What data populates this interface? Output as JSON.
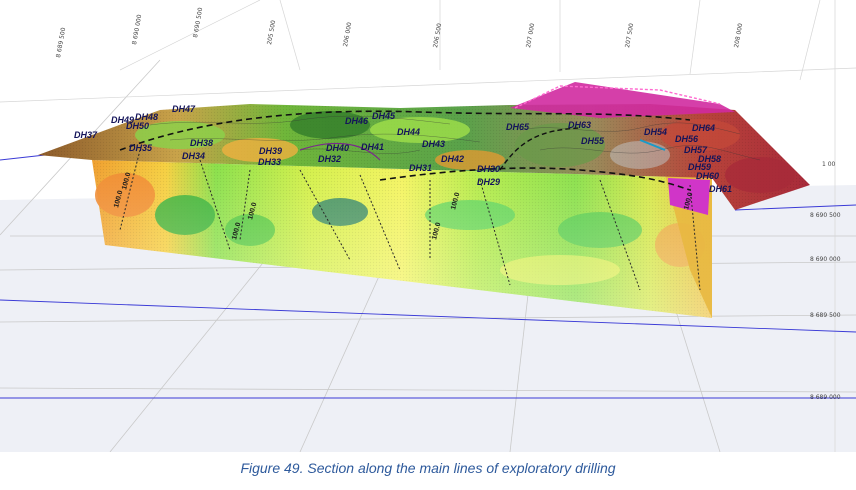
{
  "caption": "Figure 49. Section along the main lines of exploratory drilling",
  "colors": {
    "caption": "#2e5a9c",
    "label": "#14145a",
    "grid": "#c9c9c9",
    "boundary": "#2a2ad0"
  },
  "coords_top": [
    "8 689 500",
    "8 690 000",
    "8 690 500",
    "205 500",
    "206 000",
    "206 500",
    "207 000",
    "207 500",
    "208 000"
  ],
  "coords_right": [
    "1 00",
    "8 690 500",
    "8 690 000",
    "8 689 500",
    "8 689 000"
  ],
  "contour_labels": [
    "100.0",
    "100.0",
    "100.0",
    "100.0",
    "100.0",
    "100.0",
    "100.0"
  ],
  "drillholes": [
    "DH47",
    "DH48",
    "DH49",
    "DH50",
    "DH37",
    "DH35",
    "DH38",
    "DH34",
    "DH39",
    "DH33",
    "DH40",
    "DH32",
    "DH41",
    "DH46",
    "DH45",
    "DH44",
    "DH43",
    "DH42",
    "DH31",
    "DH30",
    "DH29",
    "DH65",
    "DH63",
    "DH55",
    "DH54",
    "DH64",
    "DH56",
    "DH57",
    "DH58",
    "DH59",
    "DH60",
    "DH61"
  ]
}
